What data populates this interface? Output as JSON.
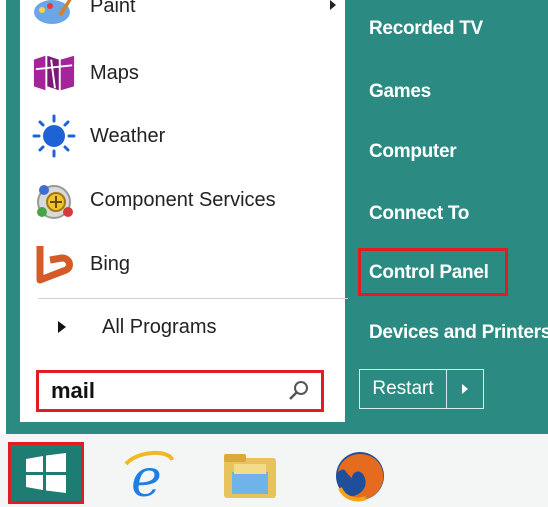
{
  "left_menu": {
    "items": [
      {
        "label": "Paint",
        "icon": "paint-icon"
      },
      {
        "label": "Maps",
        "icon": "maps-icon"
      },
      {
        "label": "Weather",
        "icon": "weather-icon"
      },
      {
        "label": "Component Services",
        "icon": "component-services-icon"
      },
      {
        "label": "Bing",
        "icon": "bing-icon"
      }
    ],
    "all_programs_label": "All Programs"
  },
  "search": {
    "value": "mail",
    "icon": "search-icon"
  },
  "right_menu": {
    "items": [
      "Recorded TV",
      "Games",
      "Computer",
      "Connect To",
      "Control Panel",
      "Devices and Printers"
    ],
    "highlighted": "Control Panel"
  },
  "power": {
    "restart_label": "Restart"
  },
  "taskbar": {
    "icons": [
      "windows-start-icon",
      "internet-explorer-icon",
      "file-explorer-icon",
      "firefox-icon"
    ]
  },
  "colors": {
    "menu_teal": "#2b8a82",
    "highlight_red": "#e31c23",
    "start_tile": "#1e7d73"
  }
}
